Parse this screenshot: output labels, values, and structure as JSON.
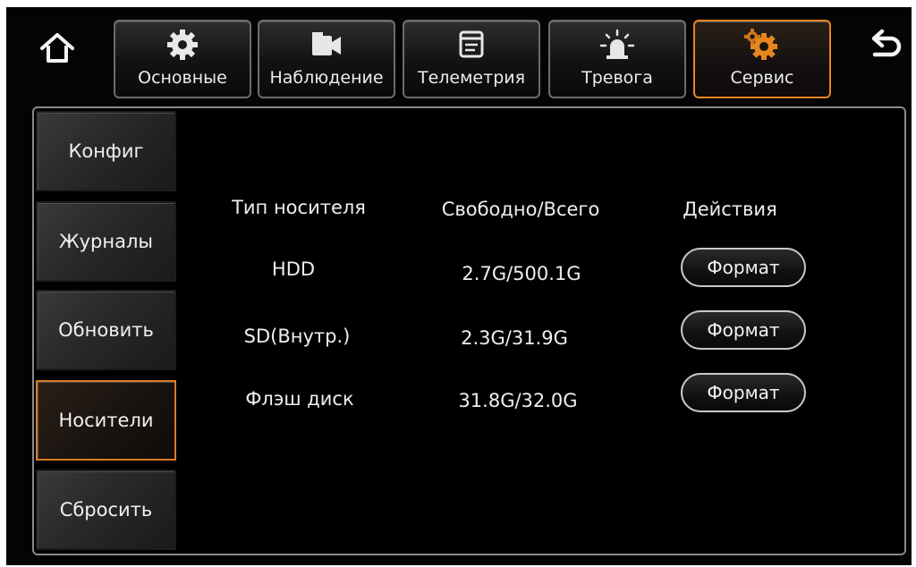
{
  "topbar": {
    "home_icon": "home-icon",
    "back_icon": "back-arrow-icon",
    "tabs": [
      {
        "label": "Основные",
        "icon": "gear-icon"
      },
      {
        "label": "Наблюдение",
        "icon": "video-camera-icon"
      },
      {
        "label": "Телеметрия",
        "icon": "window-icon"
      },
      {
        "label": "Тревога",
        "icon": "alarm-siren-icon"
      },
      {
        "label": "Сервис",
        "icon": "orange-gears-icon",
        "active": true
      }
    ]
  },
  "sidebar": {
    "items": [
      {
        "label": "Конфиг"
      },
      {
        "label": "Журналы"
      },
      {
        "label": "Обновить"
      },
      {
        "label": "Носители",
        "active": true
      },
      {
        "label": "Сбросить"
      }
    ]
  },
  "storage": {
    "headers": {
      "type": "Тип носителя",
      "space": "Свободно/Всего",
      "actions": "Действия"
    },
    "rows": [
      {
        "type": "HDD",
        "space": "2.7G/500.1G",
        "action": "Формат"
      },
      {
        "type": "SD(Внутр.)",
        "space": "2.3G/31.9G",
        "action": "Формат"
      },
      {
        "type": "Флэш диск",
        "space": "31.8G/32.0G",
        "action": "Формат"
      }
    ]
  },
  "colors": {
    "accent": "#e8861e",
    "background": "#040404",
    "text": "#eeeeee"
  }
}
